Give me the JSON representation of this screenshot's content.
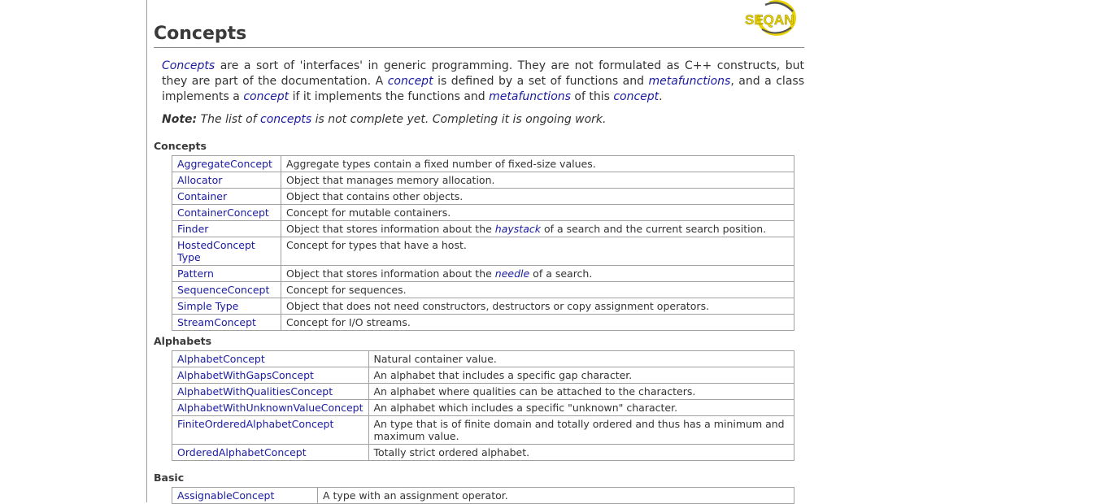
{
  "logo": {
    "text": "SEQAN"
  },
  "title": "Concepts",
  "intro": {
    "w1": "Concepts",
    "t1": " are a sort of 'interfaces' in generic programming. They are not formulated as C++ constructs, but they are part of the documentation. A ",
    "w2": "concept",
    "t2": " is defined by a set of functions and ",
    "w3": "metafunctions",
    "t3": ", and a class implements a ",
    "w4": "concept",
    "t4": " if it implements the functions and ",
    "w5": "metafunctions",
    "t5": " of this ",
    "w6": "concept",
    "t6": "."
  },
  "note": {
    "label": "Note:",
    "t1": " The list of ",
    "link": "concepts",
    "t2": " is not complete yet. Completing it is ongoing work."
  },
  "sections": {
    "concepts": {
      "title": "Concepts",
      "rows": [
        {
          "name": "AggregateConcept",
          "desc": "Aggregate types contain a fixed number of fixed-size values."
        },
        {
          "name": "Allocator",
          "desc": "Object that manages memory allocation."
        },
        {
          "name": "Container",
          "desc": "Object that contains other objects."
        },
        {
          "name": "ContainerConcept",
          "desc": "Concept for mutable containers."
        },
        {
          "name": "Finder",
          "desc_pre": "Object that stores information about the ",
          "desc_link": "haystack",
          "desc_post": " of a search and the current search position."
        },
        {
          "name": "HostedConcept Type",
          "desc": "Concept for types that have a host."
        },
        {
          "name": "Pattern",
          "desc_pre": "Object that stores information about the ",
          "desc_link": "needle",
          "desc_post": " of a search."
        },
        {
          "name": "SequenceConcept",
          "desc": "Concept for sequences."
        },
        {
          "name": "Simple Type",
          "desc": "Object that does not need constructors, destructors or copy assignment operators."
        },
        {
          "name": "StreamConcept",
          "desc": "Concept for I/O streams."
        }
      ]
    },
    "alphabets": {
      "title": "Alphabets",
      "rows": [
        {
          "name": "AlphabetConcept",
          "desc": "Natural container value."
        },
        {
          "name": "AlphabetWithGapsConcept",
          "desc": "An alphabet that includes a specific gap character."
        },
        {
          "name": "AlphabetWithQualitiesConcept",
          "desc": "An alphabet where qualities can be attached to the characters."
        },
        {
          "name": "AlphabetWithUnknownValueConcept",
          "desc": "An alphabet which includes a specific \"unknown\" character."
        },
        {
          "name": "FiniteOrderedAlphabetConcept",
          "desc": "An type that is of finite domain and totally ordered and thus has a minimum and maximum value."
        },
        {
          "name": "OrderedAlphabetConcept",
          "desc": "Totally strict ordered alphabet."
        }
      ]
    },
    "basic": {
      "title": "Basic",
      "rows": [
        {
          "name": "AssignableConcept",
          "desc": "A type with an assignment operator."
        }
      ]
    }
  },
  "colors": {
    "link": "#1a1aa0",
    "text": "#333333",
    "border": "#a0a0a0",
    "logo_yellow": "#e8d200"
  }
}
